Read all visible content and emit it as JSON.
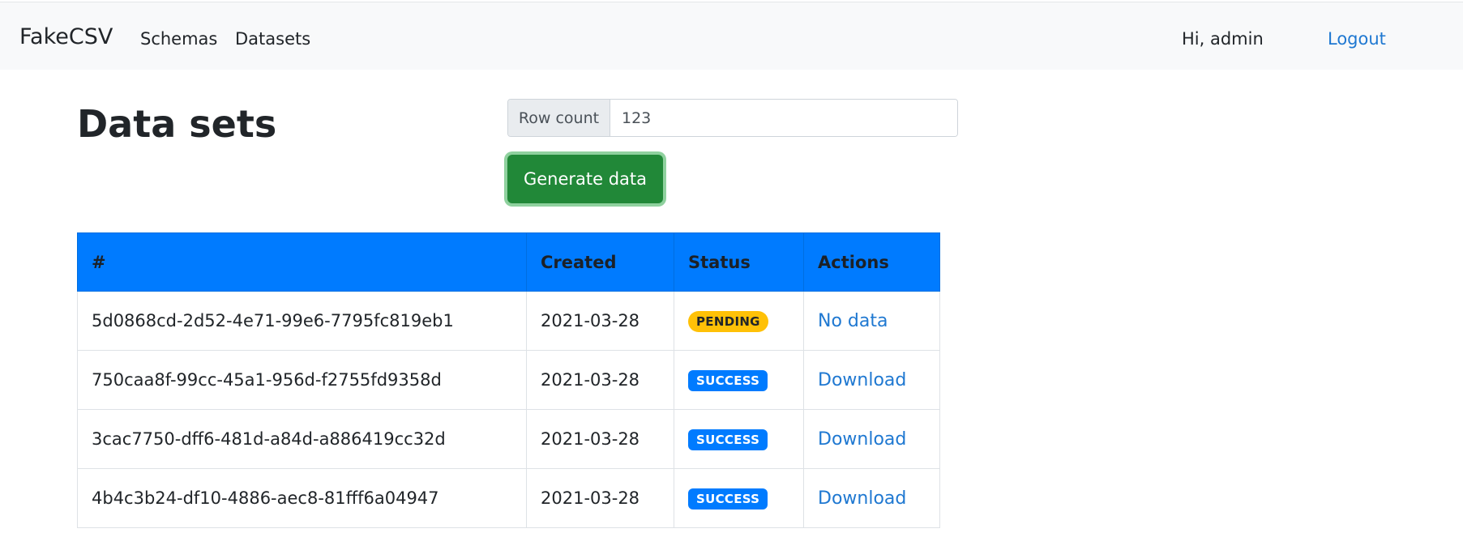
{
  "nav": {
    "brand": "FakeCSV",
    "schemas": "Schemas",
    "datasets": "Datasets",
    "greeting": "Hi, admin",
    "logout": "Logout"
  },
  "page": {
    "title": "Data sets"
  },
  "generator": {
    "row_count_label": "Row count",
    "row_count_value": "123",
    "generate_label": "Generate data"
  },
  "table": {
    "headers": [
      "#",
      "Created",
      "Status",
      "Actions"
    ],
    "rows": [
      {
        "id": "5d0868cd-2d52-4e71-99e6-7795fc819eb1",
        "created": "2021-03-28",
        "status": "PENDING",
        "action": "No data"
      },
      {
        "id": "750caa8f-99cc-45a1-956d-f2755fd9358d",
        "created": "2021-03-28",
        "status": "SUCCESS",
        "action": "Download"
      },
      {
        "id": "3cac7750-dff6-481d-a84d-a886419cc32d",
        "created": "2021-03-28",
        "status": "SUCCESS",
        "action": "Download"
      },
      {
        "id": "4b4c3b24-df10-4886-aec8-81fff6a04947",
        "created": "2021-03-28",
        "status": "SUCCESS",
        "action": "Download"
      }
    ]
  },
  "colors": {
    "header_bg": "#007bff",
    "success_badge": "#007bff",
    "pending_badge": "#ffc107",
    "generate_button": "#218838",
    "link": "#1f78d1"
  }
}
